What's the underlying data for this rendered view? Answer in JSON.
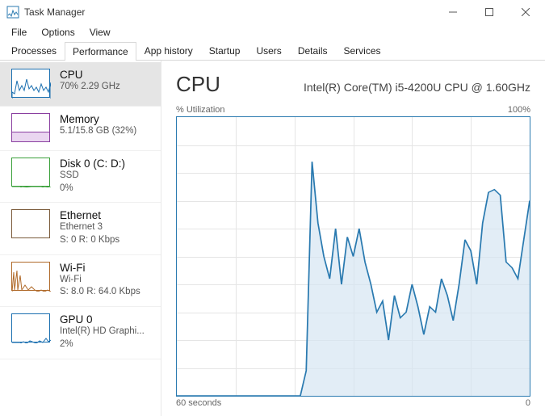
{
  "window": {
    "title": "Task Manager",
    "minimize": "—",
    "maximize": "□",
    "close": "×"
  },
  "menu": {
    "file": "File",
    "options": "Options",
    "view": "View"
  },
  "tabs": {
    "processes": "Processes",
    "performance": "Performance",
    "app_history": "App history",
    "startup": "Startup",
    "users": "Users",
    "details": "Details",
    "services": "Services"
  },
  "sidebar": {
    "items": [
      {
        "title": "CPU",
        "sub": "70% 2.29 GHz",
        "sub2": "",
        "color": "#1a6fb0"
      },
      {
        "title": "Memory",
        "sub": "5.1/15.8 GB (32%)",
        "sub2": "",
        "color": "#8a3fa0"
      },
      {
        "title": "Disk 0 (C: D:)",
        "sub": "SSD",
        "sub2": "0%",
        "color": "#3aa03a"
      },
      {
        "title": "Ethernet",
        "sub": "Ethernet 3",
        "sub2": "S: 0 R: 0 Kbps",
        "color": "#7a5a3a"
      },
      {
        "title": "Wi-Fi",
        "sub": "Wi-Fi",
        "sub2": "S: 8.0 R: 64.0 Kbps",
        "color": "#b06a2a"
      },
      {
        "title": "GPU 0",
        "sub": "Intel(R) HD Graphi...",
        "sub2": "2%",
        "color": "#1a6fb0"
      }
    ]
  },
  "main": {
    "title": "CPU",
    "description": "Intel(R) Core(TM) i5-4200U CPU @ 1.60GHz",
    "util_label": "% Utilization",
    "util_max": "100%",
    "x_left": "60 seconds",
    "x_right": "0"
  },
  "chart_data": {
    "type": "line",
    "title": "CPU % Utilization",
    "xlabel": "seconds",
    "ylabel": "% Utilization",
    "ylim": [
      0,
      100
    ],
    "xlim_label": [
      "60 seconds",
      "0"
    ],
    "x": [
      0,
      1,
      2,
      3,
      4,
      5,
      6,
      7,
      8,
      9,
      10,
      11,
      12,
      13,
      14,
      15,
      16,
      17,
      18,
      19,
      20,
      21,
      22,
      23,
      24,
      25,
      26,
      27,
      28,
      29,
      30,
      31,
      32,
      33,
      34,
      35,
      36,
      37,
      38,
      39,
      40,
      41,
      42,
      43,
      44,
      45,
      46,
      47,
      48,
      49,
      50,
      51,
      52,
      53,
      54,
      55,
      56,
      57,
      58,
      59,
      60
    ],
    "values": [
      0,
      0,
      0,
      0,
      0,
      0,
      0,
      0,
      0,
      0,
      0,
      0,
      0,
      0,
      0,
      0,
      0,
      0,
      0,
      0,
      0,
      0,
      9,
      84,
      62,
      50,
      42,
      60,
      40,
      57,
      50,
      60,
      48,
      40,
      30,
      34,
      20,
      36,
      28,
      30,
      40,
      32,
      22,
      32,
      30,
      42,
      36,
      27,
      40,
      56,
      52,
      40,
      62,
      73,
      74,
      72,
      48,
      46,
      42,
      56,
      70
    ],
    "grid": {
      "h": 10,
      "v": 6
    }
  },
  "thumbs": {
    "cpu_poly": "0,36 0,28 3,30 6,14 9,26 12,20 15,26 18,12 21,24 24,20 27,26 30,22 33,28 36,18 39,26 42,22 45,28 48,16 48,36",
    "memory_fill_pct": 32,
    "disk_poly": "0,36 10,36 12,35 24,36 36,36 40,35 48,36",
    "wifi_poly": "0,36 2,12 3,34 6,10 7,34 10,16 12,34 16,28 20,34 24,30 28,34 32,36 36,34 40,36 44,34 48,36",
    "gpu_poly": "0,36 10,36 14,34 18,36 22,33 30,36 34,33 38,35 42,30 45,34 48,32"
  }
}
